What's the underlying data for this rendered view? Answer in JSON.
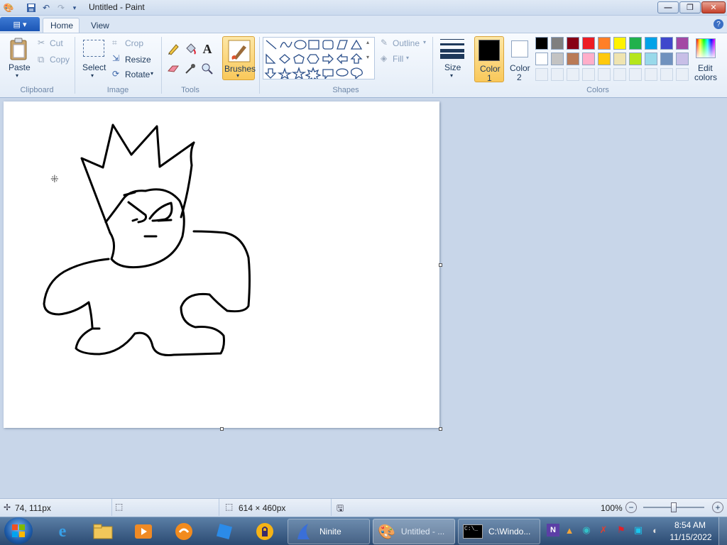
{
  "window": {
    "title": "Untitled - Paint",
    "minimize": "—",
    "restore": "❐",
    "close": "✕"
  },
  "ribbon_tabs": {
    "file_menu": "▤ ▾",
    "home": "Home",
    "view": "View"
  },
  "clipboard": {
    "paste": "Paste",
    "cut": "Cut",
    "copy": "Copy",
    "group": "Clipboard"
  },
  "image": {
    "select": "Select",
    "crop": "Crop",
    "resize": "Resize",
    "rotate": "Rotate",
    "group": "Image"
  },
  "tools": {
    "group": "Tools",
    "text_tool": "A"
  },
  "brushes": {
    "label": "Brushes"
  },
  "shapes": {
    "outline": "Outline",
    "fill": "Fill",
    "group": "Shapes"
  },
  "size": {
    "label": "Size"
  },
  "color1": {
    "label": "Color",
    "number": "1",
    "color": "#000000"
  },
  "color2": {
    "label": "Color",
    "number": "2",
    "color": "#ffffff"
  },
  "colors": {
    "group": "Colors",
    "edit_line1": "Edit",
    "edit_line2": "colors",
    "row1": [
      "#000000",
      "#7f7f7f",
      "#880015",
      "#ed1c24",
      "#ff7f27",
      "#fff200",
      "#22b14c",
      "#00a2e8",
      "#3f48cc",
      "#a349a4"
    ],
    "row2": [
      "#ffffff",
      "#c3c3c3",
      "#b97a57",
      "#ffaec9",
      "#ffc90e",
      "#efe4b0",
      "#b5e61d",
      "#99d9ea",
      "#7092be",
      "#c8bfe7"
    ]
  },
  "status": {
    "cursor_pos": "74, 111px",
    "canvas_size": "614 × 460px",
    "zoom": "100%",
    "zoom_level": 0.5
  },
  "taskbar": {
    "ninite": "Ninite",
    "paint": "Untitled - ...",
    "cmd": "C:\\Windo...",
    "time": "8:54 AM",
    "date": "11/15/2022"
  }
}
